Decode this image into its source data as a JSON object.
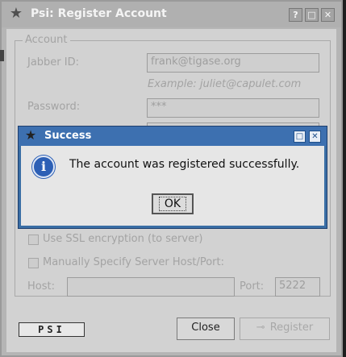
{
  "register": {
    "title": "Psi: Register Account",
    "title_buttons": {
      "help": "?",
      "maximize": "□",
      "close": "✕"
    },
    "group_label": "Account",
    "jid_label": "Jabber ID:",
    "jid_value": "frank@tigase.org",
    "jid_example": "Example: juliet@capulet.com",
    "password_label": "Password:",
    "password_value": "***",
    "ssl_label": "Use SSL encryption (to server)",
    "manual_label": "Manually Specify Server Host/Port:",
    "host_label": "Host:",
    "host_value": "",
    "port_label": "Port:",
    "port_value": "5222",
    "logo_text": "PSI",
    "close_button": "Close",
    "register_button": "Register"
  },
  "success": {
    "title": "Success",
    "title_buttons": {
      "maximize": "□",
      "close": "✕"
    },
    "message": "The account was registered successfully.",
    "ok_button": "OK",
    "icon": "info-icon"
  },
  "colors": {
    "dialog_titlebar": "#3d70b0",
    "window_background": "#d2d2d2"
  }
}
